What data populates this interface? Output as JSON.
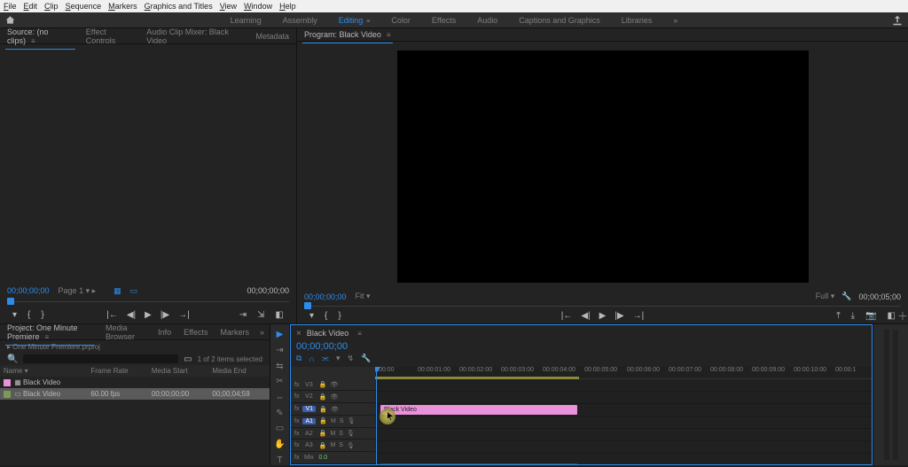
{
  "menubar": [
    "File",
    "Edit",
    "Clip",
    "Sequence",
    "Markers",
    "Graphics and Titles",
    "View",
    "Window",
    "Help"
  ],
  "workspaces": {
    "items": [
      "Learning",
      "Assembly",
      "Editing",
      "Color",
      "Effects",
      "Audio",
      "Captions and Graphics",
      "Libraries"
    ],
    "active": "Editing"
  },
  "source": {
    "tabs": [
      "Source: (no clips)",
      "Effect Controls",
      "Audio Clip Mixer: Black Video",
      "Metadata"
    ],
    "active": 0,
    "tc_left": "00;00;00;00",
    "page": "Page 1",
    "tc_right": "00;00;00;00"
  },
  "program": {
    "title": "Program: Black Video",
    "tc_left": "00;00;00;00",
    "zoom": "Fit",
    "quality": "Full",
    "tc_right": "00;00;05;00"
  },
  "project": {
    "tabs": [
      "Project: One Minute Premiere",
      "Media Browser",
      "Info",
      "Effects",
      "Markers"
    ],
    "active": 0,
    "filename": "One Minute Premiere.prproj",
    "selection": "1 of 2 items selected",
    "columns": [
      "Name",
      "Frame Rate",
      "Media Start",
      "Media End"
    ],
    "rows": [
      {
        "swatch": "sw-pink",
        "icon": "seq",
        "name": "Black Video",
        "fr": "",
        "ms": "",
        "me": ""
      },
      {
        "swatch": "sw-seq",
        "icon": "clip",
        "name": "Black Video",
        "fr": "60.00 fps",
        "ms": "00;00;00;00",
        "me": "00;00;04;59",
        "sel": true
      }
    ]
  },
  "tools": [
    "selection",
    "track-fwd",
    "ripple",
    "rolling",
    "rate",
    "slip",
    "pen",
    "rect",
    "hand",
    "type"
  ],
  "timeline": {
    "tab": "Black Video",
    "tc": "00;00;00;00",
    "ruler": [
      ":00:00",
      "00:00:01:00",
      "00:00:02:00",
      "00:00:03:00",
      "00:00:04:00",
      "00:00:05:00",
      "00:00:06:00",
      "00:00:07:00",
      "00:00:08:00",
      "00:00:09:00",
      "00:00:10:00",
      "00:00:1"
    ],
    "video_tracks": [
      "V3",
      "V2",
      "V1"
    ],
    "audio_tracks": [
      "A1",
      "A2",
      "A3"
    ],
    "clip_label": "Black Video",
    "mix_label": "Mix",
    "mix_val": "0.0"
  }
}
